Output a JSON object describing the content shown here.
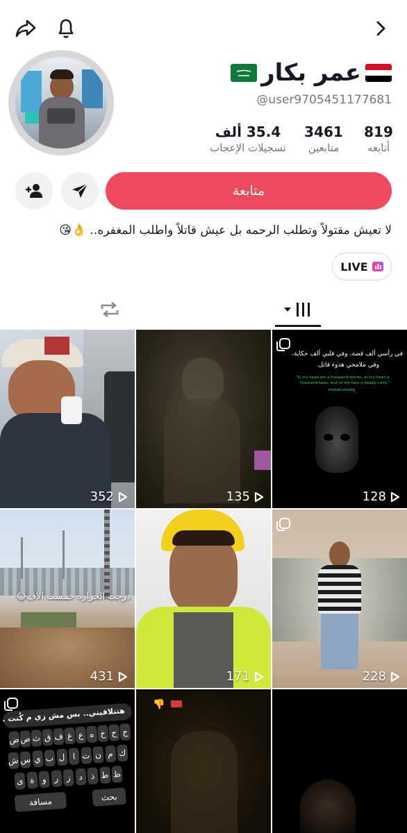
{
  "header": {
    "share_icon": "share-arrow-icon",
    "bell_icon": "bell-icon",
    "forward_icon": "chevron-right-icon"
  },
  "profile": {
    "display_name": "عمر بكار",
    "username": "@user9705451177681",
    "flags": [
      "yemen-flag",
      "saudi-flag"
    ]
  },
  "stats": [
    {
      "value": "819",
      "label": "أتابعه"
    },
    {
      "value": "3461",
      "label": "متابعين"
    },
    {
      "value": "35.4 ألف",
      "label": "تسجيلات الإعجاب"
    }
  ],
  "actions": {
    "follow_label": "متابعة",
    "message_icon": "send-icon",
    "add_friend_icon": "add-user-icon"
  },
  "bio": {
    "text": "لا تعيش مقتولاً وتطلب الرحمه بل عيش قاتلاً واطلب المغفره..",
    "emojis": "👌😘"
  },
  "live": {
    "label": "LIVE"
  },
  "tabs": [
    {
      "name": "videos",
      "icon": "grid-icon",
      "active": true
    },
    {
      "name": "reposts",
      "icon": "repost-icon",
      "active": false
    }
  ],
  "videos": [
    {
      "views": "352"
    },
    {
      "views": "135"
    },
    {
      "views": "128",
      "caption_ar_1": "في رأسي ألف قصة، وفي قلبي ألف حكاية،",
      "caption_ar_2": "وفي ملامحي هدوء قاتل.",
      "caption_en_1": "\"In my head are a thousand stories, in my heart a",
      "caption_en_2": "thousand tales, and on my face a deadly calm.\"",
      "handle": "shehab.shalby_"
    },
    {
      "views": "431",
      "caption": "درجت الحراره خمست الاف😂"
    },
    {
      "views": "171"
    },
    {
      "views": "228"
    },
    {
      "views": "",
      "keyboard_text": "هتتلاقيني.. بس مش زي م كُنت ."
    },
    {
      "views": ""
    },
    {
      "views": ""
    }
  ],
  "keyboard": {
    "row1": [
      "ج",
      "ح",
      "خ",
      "ه",
      "ع",
      "غ",
      "ف",
      "ق",
      "ث",
      "ص",
      "ض"
    ],
    "row2": [
      "ك",
      "م",
      "ن",
      "ت",
      "ا",
      "ل",
      "ب",
      "ي",
      "س",
      "ش"
    ],
    "row3": [
      "ظ",
      "ط",
      "ذ",
      "د",
      "ز",
      "ر",
      "و",
      "ة",
      "ى"
    ],
    "space": "مسافة",
    "search": "بحث"
  },
  "colors": {
    "accent": "#ed4a5f",
    "text": "#161823",
    "muted": "#75757d"
  }
}
